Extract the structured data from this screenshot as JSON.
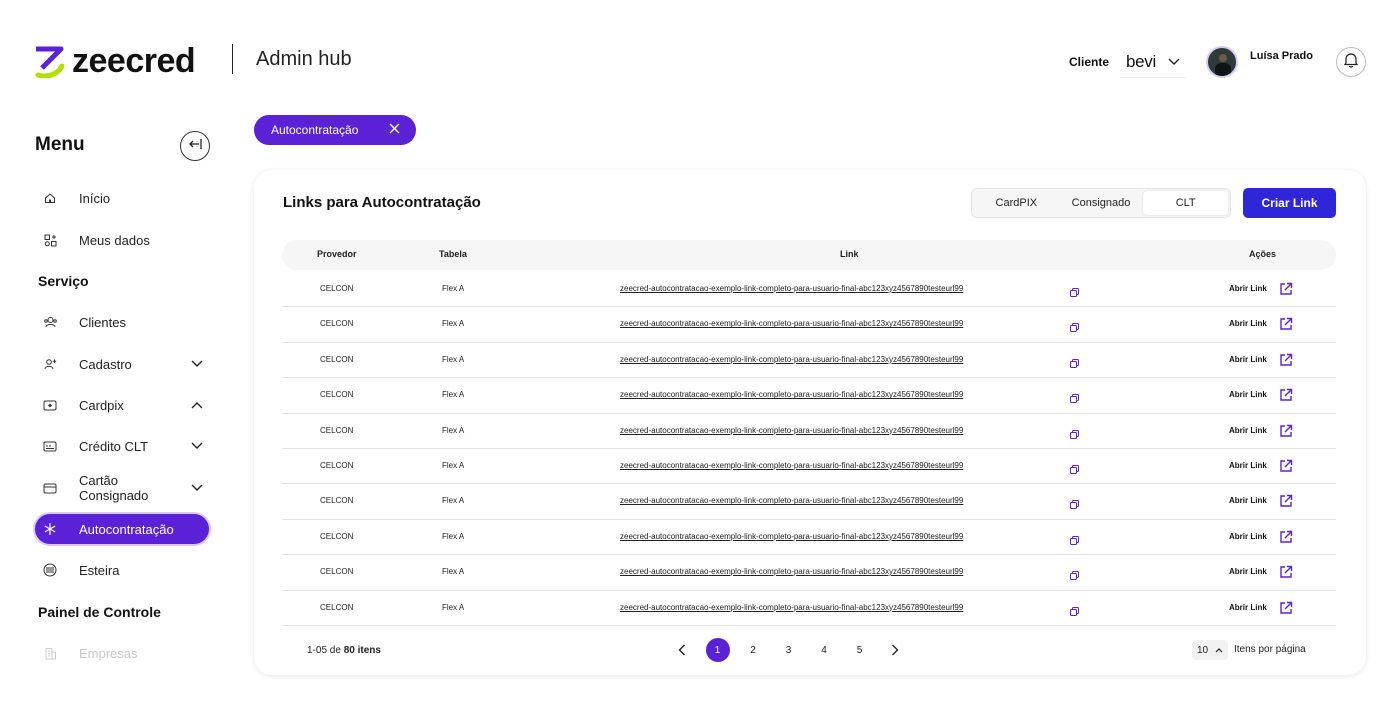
{
  "header": {
    "brand": "zeecred",
    "hub_title": "Admin hub",
    "client_label": "Cliente",
    "client_value": "bevi",
    "user_name": "Luísa Prado"
  },
  "sidebar": {
    "title": "Menu",
    "items_top": [
      {
        "label": "Início"
      },
      {
        "label": "Meus dados"
      }
    ],
    "section_service": "Serviço",
    "items_service": [
      {
        "label": "Clientes"
      },
      {
        "label": "Cadastro"
      },
      {
        "label": "Cardpix"
      },
      {
        "label": "Crédito CLT"
      },
      {
        "label": "Cartão Consignado"
      },
      {
        "label": "Autocontratação"
      },
      {
        "label": "Esteira"
      }
    ],
    "section_panel": "Painel de Controle",
    "items_panel": [
      {
        "label": "Empresas"
      }
    ]
  },
  "filter_chip": {
    "label": "Autocontratação"
  },
  "card": {
    "title": "Links para Autocontratação",
    "segments": [
      "CardPIX",
      "Consignado",
      "CLT"
    ],
    "selected_segment": "CLT",
    "create_button": "Criar Link",
    "columns": {
      "provider": "Provedor",
      "table": "Tabela",
      "link": "Link",
      "actions": "Ações"
    },
    "rows": [
      {
        "provider": "CELCON",
        "table": "Flex A",
        "link": "zeecred-autocontratacao-exemplo-link-completo-para-usuario-final-abc123xyz4567890testeurl99",
        "action": "Abrir Link"
      },
      {
        "provider": "CELCON",
        "table": "Flex A",
        "link": "zeecred-autocontratacao-exemplo-link-completo-para-usuario-final-abc123xyz4567890testeurl99",
        "action": "Abrir Link"
      },
      {
        "provider": "CELCON",
        "table": "Flex A",
        "link": "zeecred-autocontratacao-exemplo-link-completo-para-usuario-final-abc123xyz4567890testeurl99",
        "action": "Abrir Link"
      },
      {
        "provider": "CELCON",
        "table": "Flex A",
        "link": "zeecred-autocontratacao-exemplo-link-completo-para-usuario-final-abc123xyz4567890testeurl99",
        "action": "Abrir Link"
      },
      {
        "provider": "CELCON",
        "table": "Flex A",
        "link": "zeecred-autocontratacao-exemplo-link-completo-para-usuario-final-abc123xyz4567890testeurl99",
        "action": "Abrir Link"
      },
      {
        "provider": "CELCON",
        "table": "Flex A",
        "link": "zeecred-autocontratacao-exemplo-link-completo-para-usuario-final-abc123xyz4567890testeurl99",
        "action": "Abrir Link"
      },
      {
        "provider": "CELCON",
        "table": "Flex A",
        "link": "zeecred-autocontratacao-exemplo-link-completo-para-usuario-final-abc123xyz4567890testeurl99",
        "action": "Abrir Link"
      },
      {
        "provider": "CELCON",
        "table": "Flex A",
        "link": "zeecred-autocontratacao-exemplo-link-completo-para-usuario-final-abc123xyz4567890testeurl99",
        "action": "Abrir Link"
      },
      {
        "provider": "CELCON",
        "table": "Flex A",
        "link": "zeecred-autocontratacao-exemplo-link-completo-para-usuario-final-abc123xyz4567890testeurl99",
        "action": "Abrir Link"
      },
      {
        "provider": "CELCON",
        "table": "Flex A",
        "link": "zeecred-autocontratacao-exemplo-link-completo-para-usuario-final-abc123xyz4567890testeurl99",
        "action": "Abrir Link"
      }
    ],
    "footer": {
      "range": "1-05 de",
      "total": "80 itens",
      "pages": [
        "1",
        "2",
        "3",
        "4",
        "5"
      ],
      "current_page": "1",
      "per_page": "10",
      "per_page_label": "Itens por página"
    }
  },
  "colors": {
    "accent": "#5b21d6",
    "button": "#3026d9",
    "logo_green": "#b4e000"
  }
}
